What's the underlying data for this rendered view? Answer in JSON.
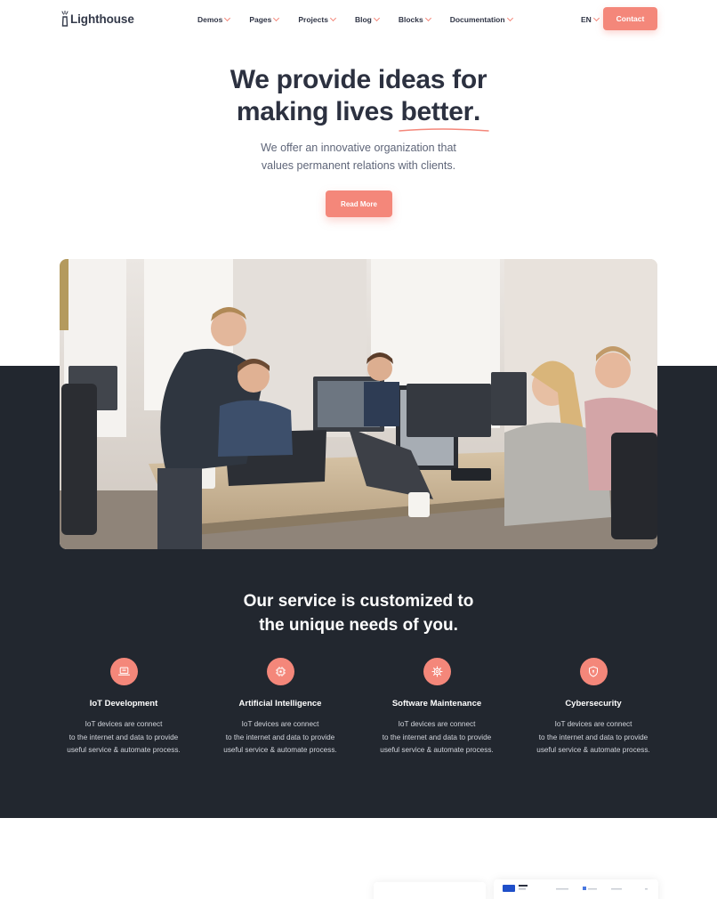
{
  "brand": {
    "name": "Lighthouse",
    "accent": "#f4877a",
    "dark_bg": "#22272f"
  },
  "nav": {
    "items": [
      {
        "label": "Demos"
      },
      {
        "label": "Pages"
      },
      {
        "label": "Projects"
      },
      {
        "label": "Blog"
      },
      {
        "label": "Blocks"
      },
      {
        "label": "Documentation"
      }
    ],
    "language": "EN",
    "contact_label": "Contact"
  },
  "hero": {
    "title_line1": "We provide ideas for",
    "title_line2_prefix": "making lives ",
    "title_highlight": "better",
    "title_suffix": ".",
    "subtitle_line1": "We offer an innovative organization that",
    "subtitle_line2": "values permanent relations with clients.",
    "cta_label": "Read More"
  },
  "services": {
    "title_line1": "Our service is customized to",
    "title_line2": "the unique needs of you.",
    "items": [
      {
        "icon": "laptop-icon",
        "title": "IoT Development",
        "desc_line1": "IoT devices are connect",
        "desc_line2": "to the internet and data to provide",
        "desc_line3": "useful service & automate process."
      },
      {
        "icon": "chip-icon",
        "title": "Artificial Intelligence",
        "desc_line1": "IoT devices are connect",
        "desc_line2": "to the internet and data to provide",
        "desc_line3": "useful service & automate process."
      },
      {
        "icon": "gear-icon",
        "title": "Software Maintenance",
        "desc_line1": "IoT devices are connect",
        "desc_line2": "to the internet and data to provide",
        "desc_line3": "useful service & automate process."
      },
      {
        "icon": "shield-icon",
        "title": "Cybersecurity",
        "desc_line1": "IoT devices are connect",
        "desc_line2": "to the internet and data to provide",
        "desc_line3": "useful service & automate process."
      }
    ]
  }
}
